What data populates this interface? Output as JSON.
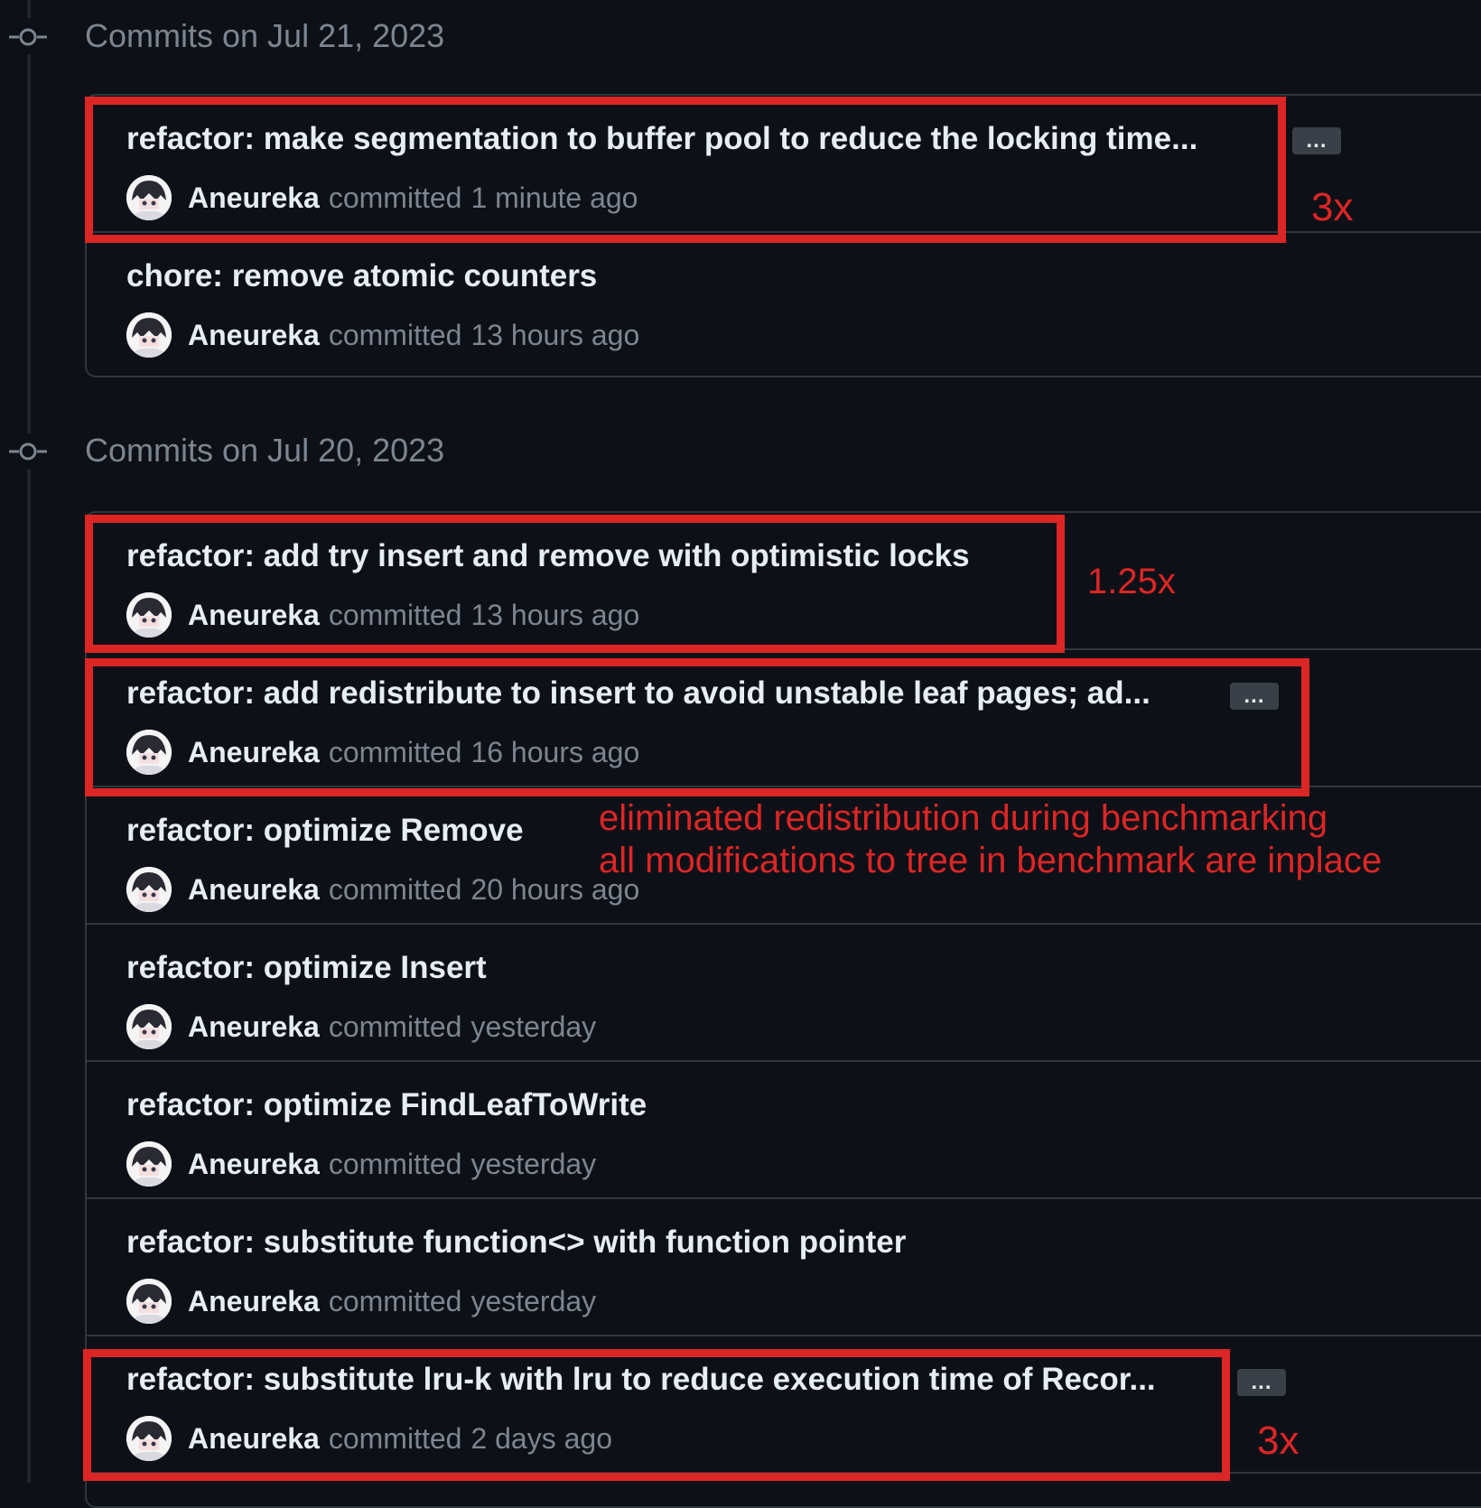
{
  "groups": [
    {
      "header": "Commits on Jul 21, 2023",
      "commits": [
        {
          "title": "refactor: make segmentation to buffer pool to reduce the locking time...",
          "author": "Aneureka",
          "verb": "committed",
          "time": "1 minute ago",
          "has_ellipsis": true
        },
        {
          "title": "chore: remove atomic counters",
          "author": "Aneureka",
          "verb": "committed",
          "time": "13 hours ago",
          "has_ellipsis": false
        }
      ]
    },
    {
      "header": "Commits on Jul 20, 2023",
      "commits": [
        {
          "title": "refactor: add try insert and remove with optimistic locks",
          "author": "Aneureka",
          "verb": "committed",
          "time": "13 hours ago",
          "has_ellipsis": false
        },
        {
          "title": "refactor: add redistribute to insert to avoid unstable leaf pages; ad...",
          "author": "Aneureka",
          "verb": "committed",
          "time": "16 hours ago",
          "has_ellipsis": true
        },
        {
          "title": "refactor: optimize Remove",
          "author": "Aneureka",
          "verb": "committed",
          "time": "20 hours ago",
          "has_ellipsis": false
        },
        {
          "title": "refactor: optimize Insert",
          "author": "Aneureka",
          "verb": "committed",
          "time": "yesterday",
          "has_ellipsis": false
        },
        {
          "title": "refactor: optimize FindLeafToWrite",
          "author": "Aneureka",
          "verb": "committed",
          "time": "yesterday",
          "has_ellipsis": false
        },
        {
          "title": "refactor: substitute function<> with function pointer",
          "author": "Aneureka",
          "verb": "committed",
          "time": "yesterday",
          "has_ellipsis": false
        },
        {
          "title": "refactor: substitute lru-k with lru to reduce execution time of Recor...",
          "author": "Aneureka",
          "verb": "committed",
          "time": "2 days ago",
          "has_ellipsis": true
        }
      ]
    }
  ],
  "ellipsis_label": "...",
  "annotations": {
    "speedup_buffer_pool": "3x",
    "speedup_optimistic": "1.25x",
    "note_line1": "eliminated redistribution during benchmarking",
    "note_line2": "all modifications to tree in benchmark are inplace",
    "speedup_lru": "3x"
  },
  "colors": {
    "background": "#0d1117",
    "annotation_red": "#dc2626",
    "muted_text": "#7d8590",
    "primary_text": "#e6edf3",
    "border": "#30363d"
  }
}
